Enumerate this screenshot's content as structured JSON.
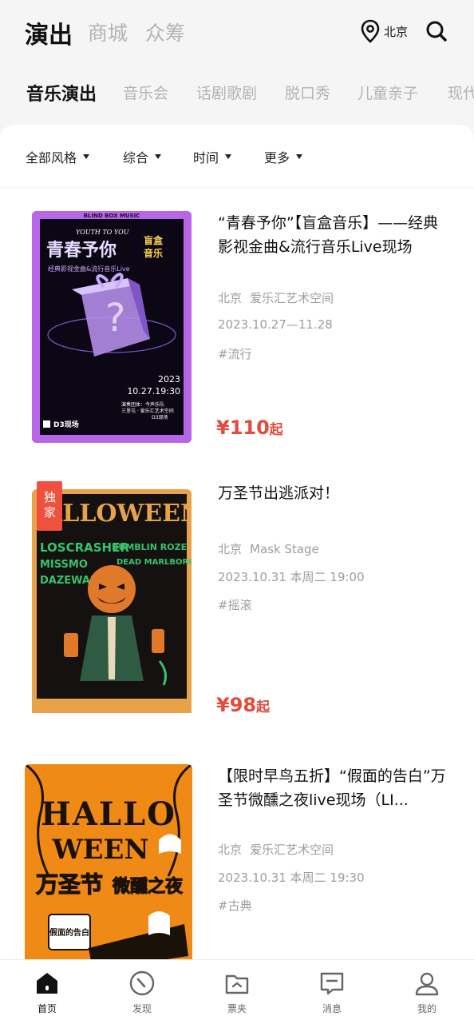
{
  "top_tabs": [
    "演出",
    "商城",
    "众筹"
  ],
  "location": "北京",
  "categories": [
    "音乐演出",
    "音乐会",
    "话剧歌剧",
    "脱口秀",
    "儿童亲子",
    "现代"
  ],
  "filters": [
    "全部风格",
    "综合",
    "时间",
    "更多"
  ],
  "items": [
    {
      "title": "“青春予你”【盲盒音乐】——经典影视金曲&流行音乐Live现场",
      "city": "北京",
      "venue": "爱乐汇艺术空间",
      "date": "2023.10.27—11.28",
      "tag": "#流行",
      "price": "¥110",
      "price_suffix": "起",
      "poster": {
        "top_band": "BLIND BOX MUSIC",
        "english": "YOUTH TO YOU",
        "main": "青春予你",
        "box": "盲盒",
        "box2": "音乐",
        "sub": "经典影视金曲&流行音乐Live",
        "year": "2023",
        "datetime": "10.27.19:30",
        "org1": "演奏团体：今声乐队",
        "org2": "三里屯 · 爱乐汇艺术空间",
        "org3": "D3现场",
        "brand": "D3现场"
      }
    },
    {
      "title": "万圣节出逃派对！",
      "city": "北京",
      "venue": "Mask Stage",
      "date": "2023.10.31 本周二 19:00",
      "tag": "#摇滚",
      "price": "¥98",
      "price_suffix": "起",
      "badge": "独家",
      "poster": {
        "headline": "HALLOWEEN",
        "bands_left": "LOSCRASHER",
        "bands_left2": "MISSMO",
        "bands_left3": "DAZEWAN",
        "bands_right": "BUMBLIN ROZE",
        "bands_right2": "DEAD MARLBORO"
      }
    },
    {
      "title": "【限时早鸟五折】“假面的告白”万圣节微醺之夜live现场（LI...",
      "city": "北京",
      "venue": "爱乐汇艺术空间",
      "date": "2023.10.31 本周二 19:30",
      "tag": "#古典",
      "poster": {
        "word1": "HALLO",
        "word2": "WEEN",
        "cn": "万圣节",
        "cn2": "微醺之夜",
        "stamp": "假面的告白"
      }
    }
  ],
  "bottom_nav": [
    "首页",
    "发现",
    "票夹",
    "消息",
    "我的"
  ],
  "colors": {
    "accent": "#e44b3b",
    "muted": "#b3b3b3"
  }
}
